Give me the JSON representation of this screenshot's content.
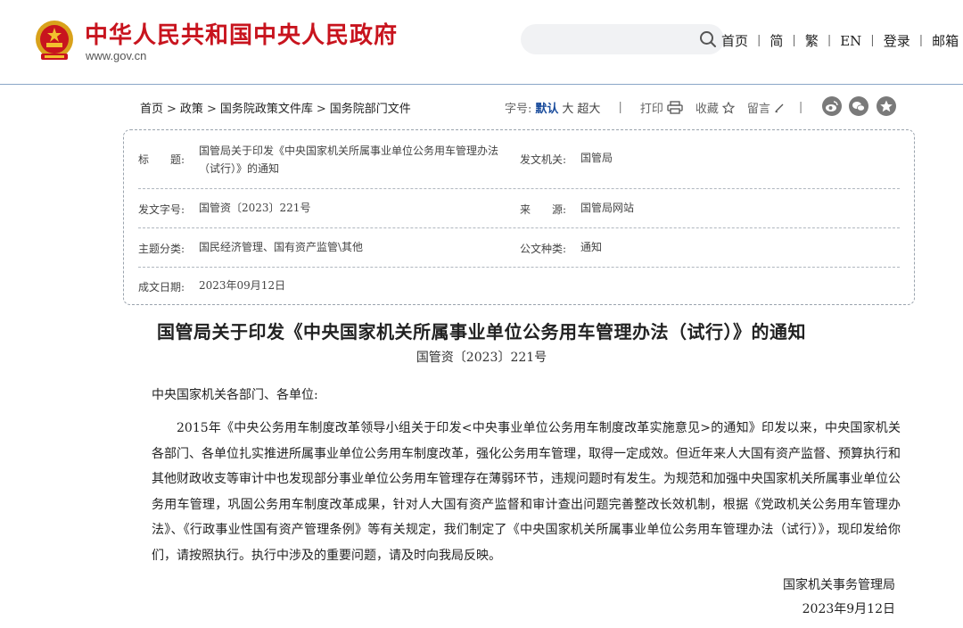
{
  "header": {
    "site_title": "中华人民共和国中央人民政府",
    "site_url": "www.gov.cn",
    "nav": [
      "首页",
      "简",
      "繁",
      "EN",
      "登录",
      "邮箱"
    ],
    "brand_color": "#c8141e"
  },
  "breadcrumb": [
    "首页",
    "政策",
    "国务院政策文件库",
    "国务院部门文件"
  ],
  "tools": {
    "font_size_label": "字号:",
    "size_default": "默认",
    "size_large": "大",
    "size_xlarge": "超大",
    "print": "打印",
    "favorite": "收藏",
    "comment": "留言",
    "share_icons": [
      "weibo-icon",
      "wechat-icon",
      "star-icon"
    ]
  },
  "info": {
    "title_label": "标　　题:",
    "title_value": "国管局关于印发《中央国家机关所属事业单位公务用车管理办法（试行）》的通知",
    "issuer_label": "发文机关:",
    "issuer_value": "国管局",
    "doc_no_label": "发文字号:",
    "doc_no_value": "国管资〔2023〕221号",
    "source_label": "来　　源:",
    "source_value": "国管局网站",
    "topic_label": "主题分类:",
    "topic_value": "国民经济管理、国有资产监管\\其他",
    "type_label": "公文种类:",
    "type_value": "通知",
    "date_label": "成文日期:",
    "date_value": "2023年09月12日"
  },
  "document": {
    "title": "国管局关于印发《中央国家机关所属事业单位公务用车管理办法（试行）》的通知",
    "number": "国管资〔2023〕221号",
    "salutation": "中央国家机关各部门、各单位:",
    "paragraph": "2015年《中央公务用车制度改革领导小组关于印发<中央事业单位公务用车制度改革实施意见>的通知》印发以来，中央国家机关各部门、各单位扎实推进所属事业单位公务用车制度改革，强化公务用车管理，取得一定成效。但近年来人大国有资产监督、预算执行和其他财政收支等审计中也发现部分事业单位公务用车管理存在薄弱环节，违规问题时有发生。为规范和加强中央国家机关所属事业单位公务用车管理，巩固公务用车制度改革成果，针对人大国有资产监督和审计查出问题完善整改长效机制，根据《党政机关公务用车管理办法》、《行政事业性国有资产管理条例》等有关规定，我们制定了《中央国家机关所属事业单位公务用车管理办法（试行）》，现印发给你们，请按照执行。执行中涉及的重要问题，请及时向我局反映。",
    "signer": "国家机关事务管理局",
    "sign_date": "2023年9月12日"
  }
}
